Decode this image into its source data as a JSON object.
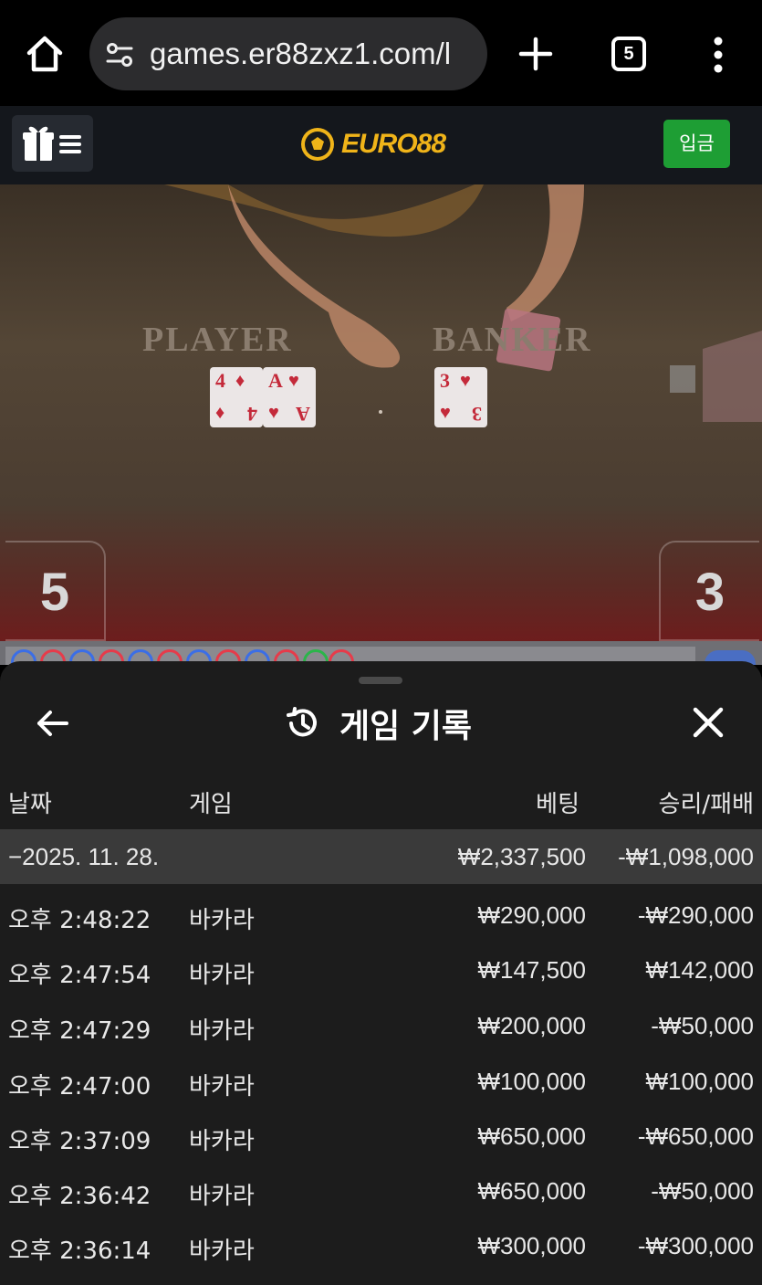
{
  "browser": {
    "url": "games.er88zxz1.com/l",
    "tab_count": "5",
    "icons": [
      "home-icon",
      "site-info-icon",
      "plus-icon",
      "tabs-icon",
      "more-vert-icon"
    ]
  },
  "header": {
    "logo_text": "EURO88",
    "deposit_label": "입금",
    "accent_color": "#f0b419",
    "deposit_color": "#1e9e34"
  },
  "video": {
    "player_label": "PLAYER",
    "banker_label": "BANKER",
    "player_cards": [
      {
        "rank": "4",
        "suit": "♦"
      },
      {
        "rank": "A",
        "suit": "♥"
      }
    ],
    "banker_cards": [
      {
        "rank": "3",
        "suit": "♥"
      }
    ],
    "player_score": "5",
    "banker_score": "3"
  },
  "sheet": {
    "title": "게임 기록",
    "columns": {
      "date": "날짜",
      "game": "게임",
      "bet": "베팅",
      "win_loss": "승리/패배"
    },
    "summary": {
      "date": "−2025. 11. 28.",
      "bet": "₩2,337,500",
      "win_loss": "-₩1,098,000"
    },
    "rows": [
      {
        "time": "오후 2:48:22",
        "game": "바카라",
        "bet": "₩290,000",
        "win_loss": "-₩290,000"
      },
      {
        "time": "오후 2:47:54",
        "game": "바카라",
        "bet": "₩147,500",
        "win_loss": "₩142,000"
      },
      {
        "time": "오후 2:47:29",
        "game": "바카라",
        "bet": "₩200,000",
        "win_loss": "-₩50,000"
      },
      {
        "time": "오후 2:47:00",
        "game": "바카라",
        "bet": "₩100,000",
        "win_loss": "₩100,000"
      },
      {
        "time": "오후 2:37:09",
        "game": "바카라",
        "bet": "₩650,000",
        "win_loss": "-₩650,000"
      },
      {
        "time": "오후 2:36:42",
        "game": "바카라",
        "bet": "₩650,000",
        "win_loss": "-₩50,000"
      },
      {
        "time": "오후 2:36:14",
        "game": "바카라",
        "bet": "₩300,000",
        "win_loss": "-₩300,000"
      }
    ]
  }
}
